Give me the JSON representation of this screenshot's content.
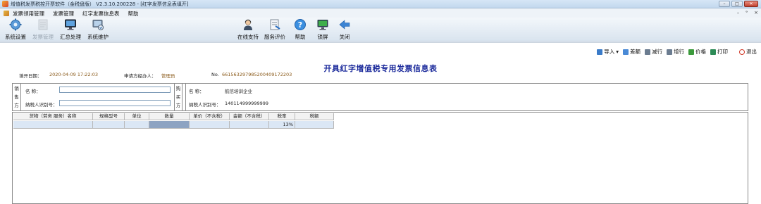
{
  "window": {
    "title": "增值税发票税控开票软件（金税盘版） V2.3.10.200228 - [红字发票信息表填开]",
    "min_label": "–",
    "max_label": "□",
    "close_label": "✕"
  },
  "menu": {
    "items": [
      "发票领用管理",
      "发票管理",
      "红字发票信息表",
      "帮助"
    ],
    "mdi_controls": [
      "–",
      "ᵊ",
      "×"
    ]
  },
  "toolbar": {
    "left": [
      {
        "label": "系统设置",
        "icon": "gear-icon",
        "disabled": false
      },
      {
        "label": "发票管理",
        "icon": "invoice-icon",
        "disabled": true
      },
      {
        "label": "汇总处理",
        "icon": "monitor-icon",
        "disabled": false
      },
      {
        "label": "系统维护",
        "icon": "maintenance-icon",
        "disabled": false
      }
    ],
    "right": [
      {
        "label": "在线支持",
        "icon": "support-person-icon"
      },
      {
        "label": "服务评价",
        "icon": "rating-icon"
      },
      {
        "label": "帮助",
        "icon": "help-icon"
      },
      {
        "label": "锁屏",
        "icon": "lock-screen-icon"
      },
      {
        "label": "关闭",
        "icon": "back-arrow-icon"
      }
    ]
  },
  "actions": [
    {
      "label": "导入",
      "icon": "import-icon",
      "color": "#3a7bc8",
      "dropdown": "▾"
    },
    {
      "label": "差额",
      "icon": "difference-icon",
      "color": "#4a8ad6"
    },
    {
      "label": "减行",
      "icon": "remove-row-icon",
      "color": "#6b7c90"
    },
    {
      "label": "增行",
      "icon": "add-row-icon",
      "color": "#6b7c90"
    },
    {
      "label": "价格",
      "icon": "price-icon",
      "color": "#3c9a3c"
    },
    {
      "label": "打印",
      "icon": "print-icon",
      "color": "#2e8b57"
    },
    {
      "label": "退出",
      "icon": "exit-icon",
      "color": "#d03a2a"
    }
  ],
  "form": {
    "title": "开具红字增值税专用发票信息表",
    "fill_date_label": "填开日期：",
    "fill_date": "2020-04-09 17:22:03",
    "applicant_label": "申请方经办人：",
    "applicant": "管理员",
    "number_label": "No.",
    "number": "661563297985200409172203"
  },
  "seller": {
    "side_label": [
      "销",
      "售",
      "方"
    ],
    "name_label": "名        称：",
    "name_value": "",
    "taxid_label": "纳税人识别号：",
    "taxid_value": ""
  },
  "buyer": {
    "side_label": [
      "购",
      "买",
      "方"
    ],
    "name_label": "名        称：",
    "name_value": "航信培训企业",
    "taxid_label": "纳税人识别号：",
    "taxid_value": "140114999999999"
  },
  "grid": {
    "headers": [
      "货物（劳务 服务）名称",
      "规格型号",
      "单位",
      "数量",
      "单价（不含税）",
      "金额（不含税）",
      "税率",
      "税额"
    ],
    "rows": [
      [
        "",
        "",
        "",
        "",
        "",
        "",
        "13%",
        ""
      ]
    ]
  }
}
